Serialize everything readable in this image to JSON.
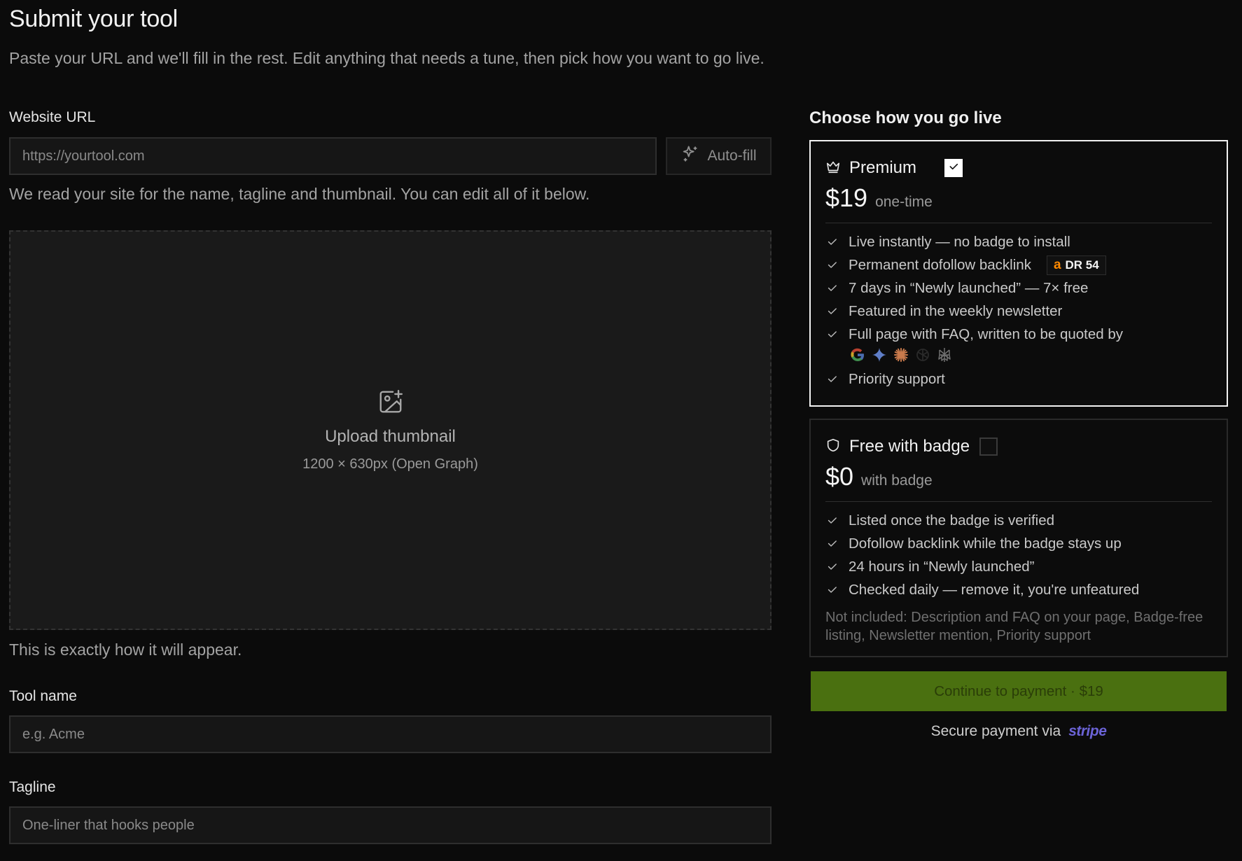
{
  "header": {
    "title": "Submit your tool",
    "subtitle": "Paste your URL and we'll fill in the rest. Edit anything that needs a tune, then pick how you want to go live."
  },
  "url_field": {
    "label": "Website URL",
    "placeholder": "https://yourtool.com",
    "autofill_label": "Auto-fill",
    "hint": "We read your site for the name, tagline and thumbnail. You can edit all of it below."
  },
  "upload": {
    "title": "Upload thumbnail",
    "subtitle": "1200 × 630px (Open Graph)",
    "caption": "This is exactly how it will appear."
  },
  "tool_name": {
    "label": "Tool name",
    "placeholder": "e.g. Acme"
  },
  "tagline": {
    "label": "Tagline",
    "placeholder": "One-liner that hooks people"
  },
  "plans_title": "Choose how you go live",
  "premium": {
    "name": "Premium",
    "checked": true,
    "price": "$19",
    "price_note": "one-time",
    "features": [
      "Live instantly — no badge to install",
      "Permanent dofollow backlink",
      "7 days in “Newly launched” — 7× free",
      "Featured in the weekly newsletter",
      "Full page with FAQ, written to be quoted by",
      "Priority support"
    ],
    "dr_badge": {
      "letter": "a",
      "text": "DR 54",
      "color": "#ff8a00"
    },
    "ai_icons": [
      "google-icon",
      "gemini-icon",
      "claude-icon",
      "openai-icon",
      "perplexity-icon"
    ]
  },
  "free": {
    "name": "Free with badge",
    "checked": false,
    "price": "$0",
    "price_note": "with badge",
    "features": [
      "Listed once the badge is verified",
      "Dofollow backlink while the badge stays up",
      "24 hours in “Newly launched”",
      "Checked daily — remove it, you're unfeatured"
    ],
    "not_included": "Not included: Description and FAQ on your page, Badge-free listing, Newsletter mention, Priority support"
  },
  "payment": {
    "button_label": "Continue to payment · $19",
    "secure_text": "Secure payment via",
    "provider": "stripe"
  },
  "colors": {
    "background": "#0b0b0b",
    "pay_button": "#4a7010",
    "stripe": "#6b63d6",
    "ahrefs": "#ff8a00"
  }
}
